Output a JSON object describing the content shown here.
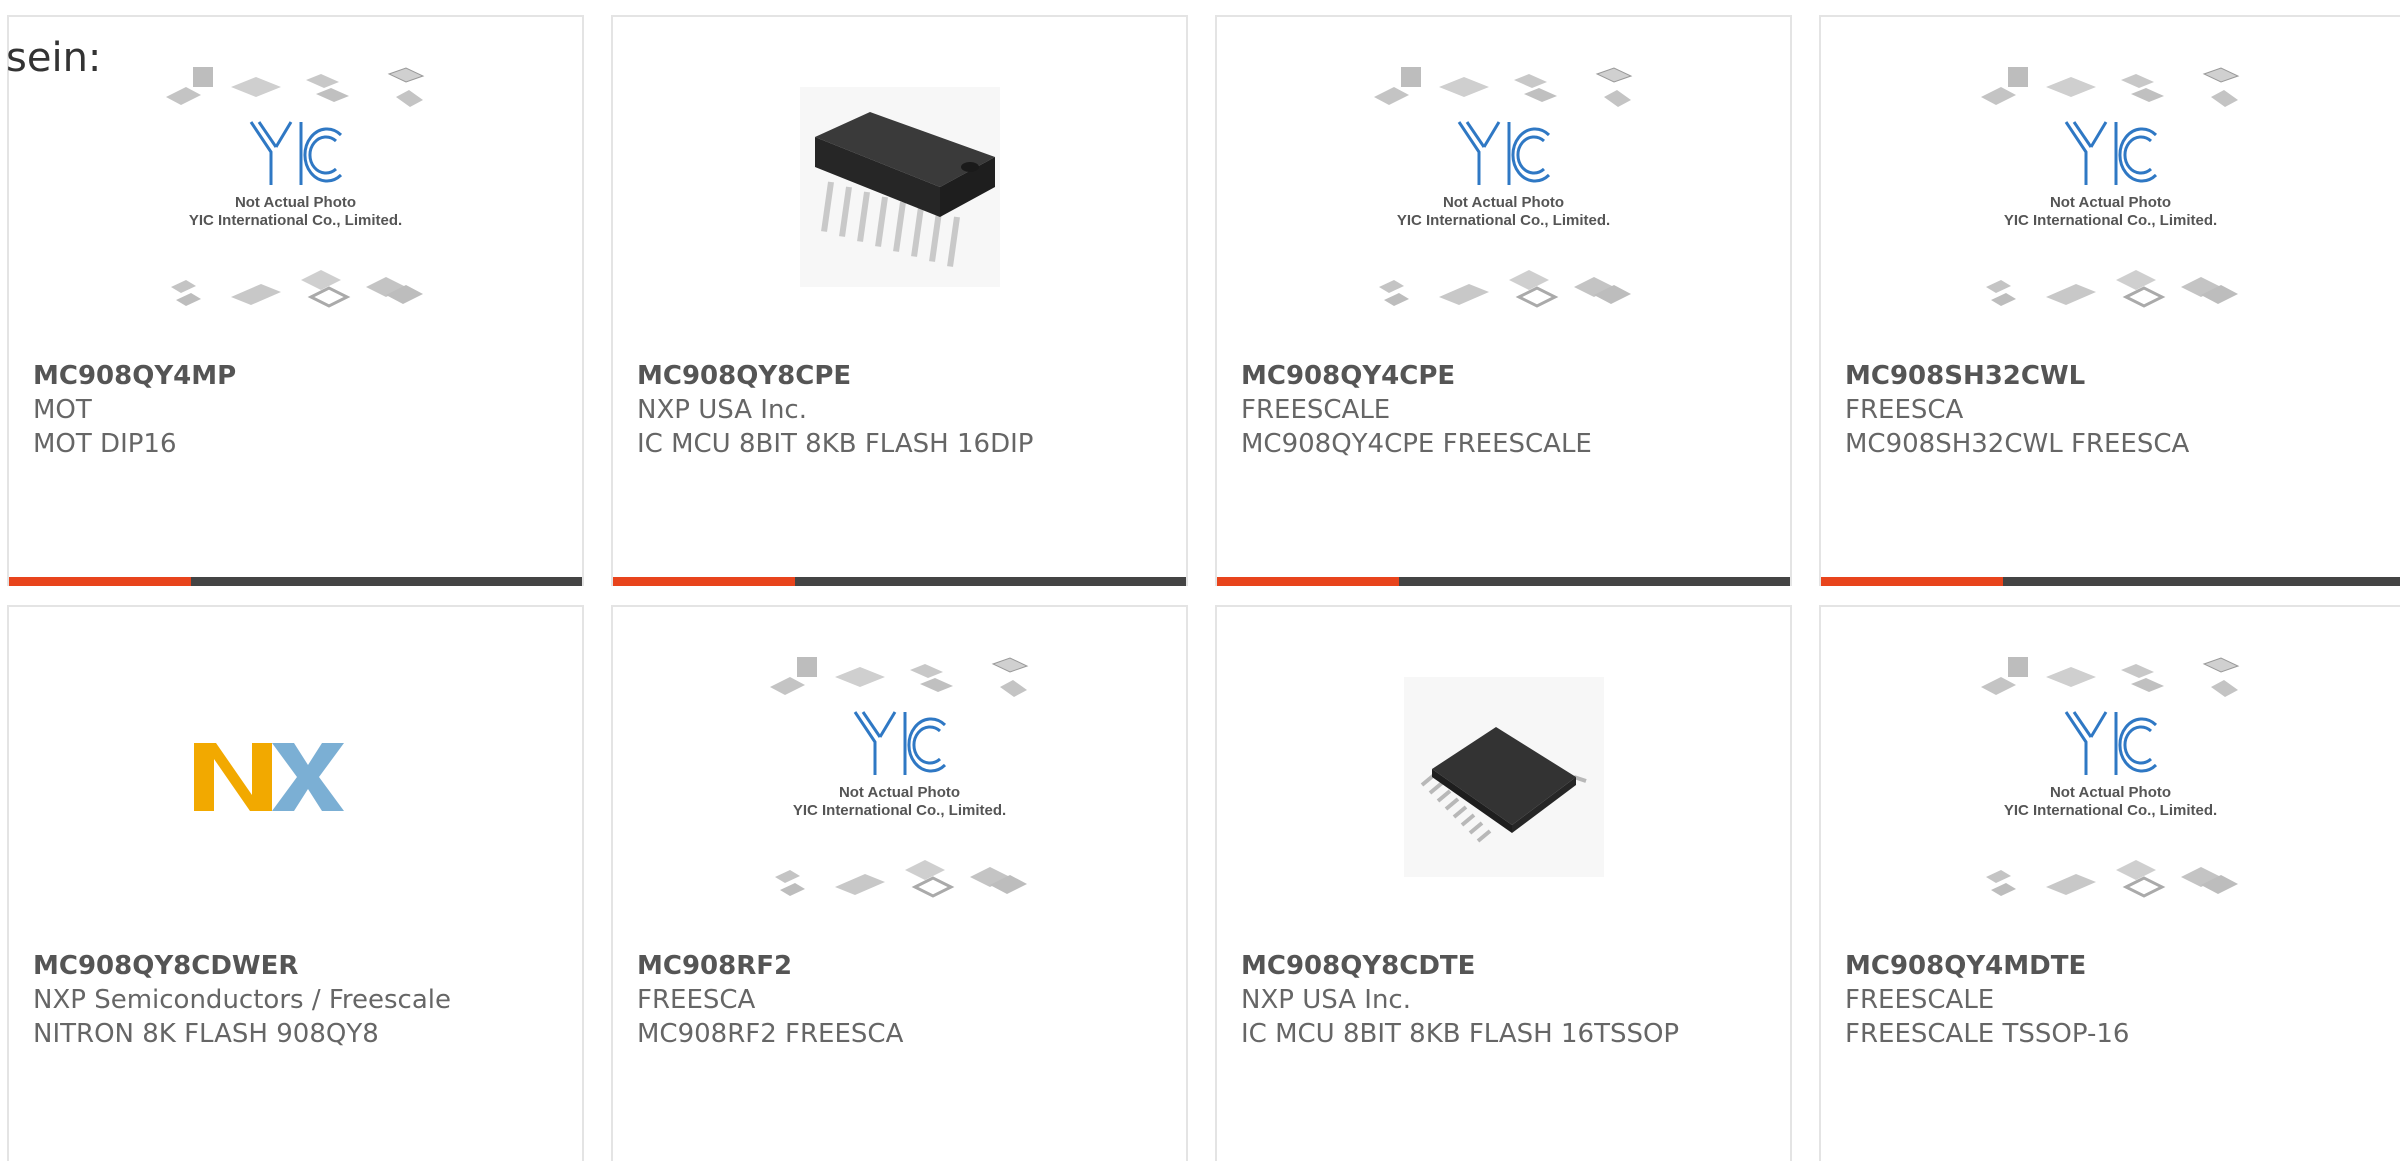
{
  "intro": {
    "text": "sein:"
  },
  "placeholder": {
    "line1": "Not Actual Photo",
    "line2": "YIC International Co., Limited.",
    "logo": "YIC"
  },
  "nxp_logo": {
    "text": "NXP"
  },
  "colors": {
    "accent": "#e8441c",
    "bar": "#444444",
    "border": "#e4e4e4",
    "text": "#666666",
    "yic_blue": "#2f78c4"
  },
  "products": [
    {
      "part": "MC908QY4MP",
      "maker": "MOT",
      "desc": "MOT DIP16",
      "image": "placeholder"
    },
    {
      "part": "MC908QY8CPE",
      "maker": "NXP USA Inc.",
      "desc": "IC MCU 8BIT 8KB FLASH 16DIP",
      "image": "dip-chip"
    },
    {
      "part": "MC908QY4CPE",
      "maker": "FREESCALE",
      "desc": "MC908QY4CPE FREESCALE",
      "image": "placeholder"
    },
    {
      "part": "MC908SH32CWL",
      "maker": "FREESCA",
      "desc": "MC908SH32CWL FREESCA",
      "image": "placeholder"
    },
    {
      "part": "MC908QY8CDWER",
      "maker": "NXP Semiconductors / Freescale",
      "desc": "NITRON 8K FLASH 908QY8",
      "image": "nxp-logo"
    },
    {
      "part": "MC908RF2",
      "maker": "FREESCA",
      "desc": "MC908RF2 FREESCA",
      "image": "placeholder"
    },
    {
      "part": "MC908QY8CDTE",
      "maker": "NXP USA Inc.",
      "desc": "IC MCU 8BIT 8KB FLASH 16TSSOP",
      "image": "tssop-chip"
    },
    {
      "part": "MC908QY4MDTE",
      "maker": "FREESCALE",
      "desc": "FREESCALE TSSOP-16",
      "image": "placeholder"
    }
  ]
}
